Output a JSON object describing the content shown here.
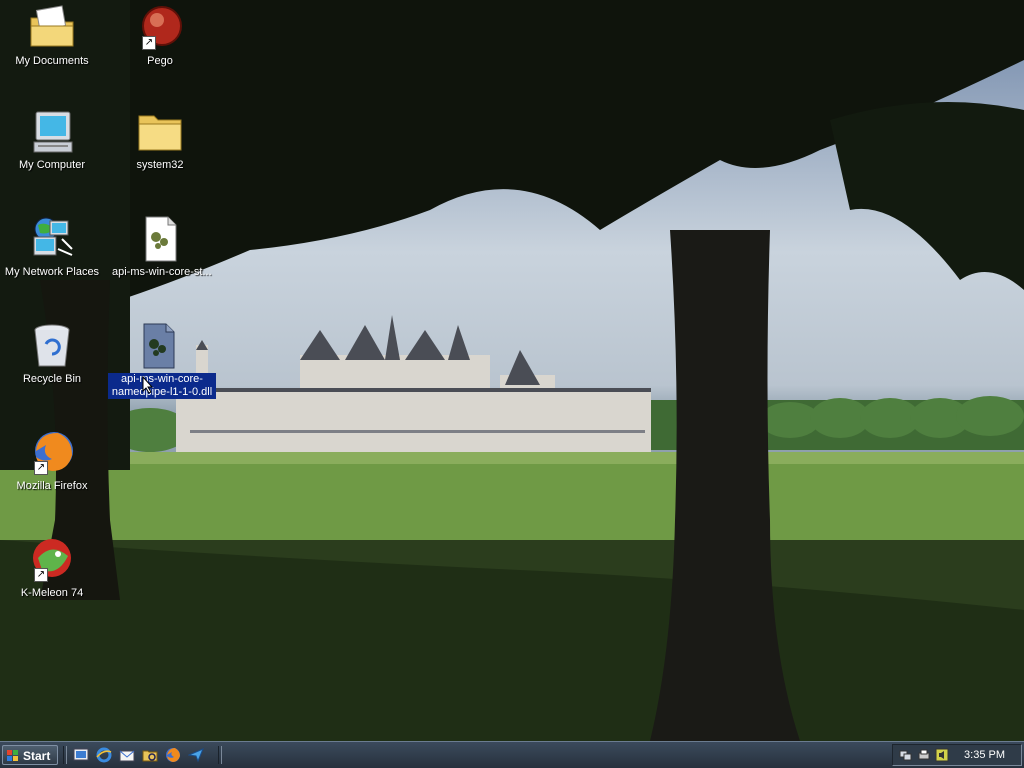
{
  "desktop": {
    "icons": [
      {
        "label": "My Documents"
      },
      {
        "label": "Pego"
      },
      {
        "label": "My Computer"
      },
      {
        "label": "system32"
      },
      {
        "label": "My Network Places"
      },
      {
        "label": "api-ms-win-core-st..."
      },
      {
        "label": "Recycle Bin"
      },
      {
        "label": "api-ms-win-core-namedpipe-l1-1-0.dll"
      },
      {
        "label": "Mozilla Firefox"
      },
      {
        "label": "K-Meleon 74"
      }
    ]
  },
  "taskbar": {
    "start_label": "Start",
    "quick_launch": [
      "show-desktop-icon",
      "internet-explorer-icon",
      "outlook-express-icon",
      "windows-explorer-icon",
      "firefox-icon",
      "send-icon"
    ],
    "clock": "3:35 PM"
  },
  "colors": {
    "selection": "#0b2a8c",
    "taskbar": "#2f3b48"
  }
}
